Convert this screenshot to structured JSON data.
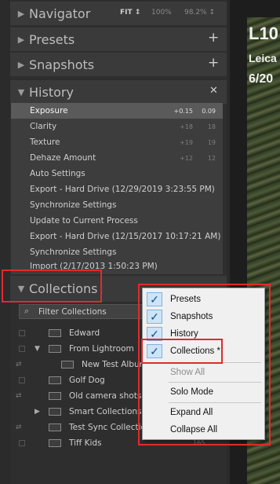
{
  "navigator": {
    "title": "Navigator",
    "fit": "FIT ↕",
    "zoom1": "100%",
    "zoom2": "98.2% ↕"
  },
  "presets": {
    "title": "Presets",
    "action": "+"
  },
  "snapshots": {
    "title": "Snapshots",
    "action": "+"
  },
  "history": {
    "title": "History",
    "action": "✕",
    "items": [
      {
        "label": "Exposure",
        "v1": "+0.15",
        "v2": "0.09"
      },
      {
        "label": "Clarity",
        "v1": "+18",
        "v2": "18"
      },
      {
        "label": "Texture",
        "v1": "+19",
        "v2": "19"
      },
      {
        "label": "Dehaze Amount",
        "v1": "+12",
        "v2": "12"
      },
      {
        "label": "Auto Settings",
        "v1": "",
        "v2": ""
      },
      {
        "label": "Export - Hard Drive (12/29/2019 3:23:55 PM)",
        "v1": "",
        "v2": ""
      },
      {
        "label": "Synchronize Settings",
        "v1": "",
        "v2": ""
      },
      {
        "label": "Update to Current Process",
        "v1": "",
        "v2": ""
      },
      {
        "label": "Export - Hard Drive (12/15/2017 10:17:21 AM)",
        "v1": "",
        "v2": ""
      },
      {
        "label": "Synchronize Settings",
        "v1": "",
        "v2": ""
      },
      {
        "label": "Import (2/17/2013 1:50:23 PM)",
        "v1": "",
        "v2": ""
      }
    ]
  },
  "collections": {
    "title": "Collections",
    "filter_placeholder": "Filter Collections",
    "items": [
      {
        "label": "Edward"
      },
      {
        "label": "From Lightroom"
      },
      {
        "label": "New Test Album"
      },
      {
        "label": "Golf Dog"
      },
      {
        "label": "Old camera shots"
      },
      {
        "label": "Smart Collections"
      },
      {
        "label": "Test Sync Collection"
      },
      {
        "label": "Tiff Kids",
        "count": "165"
      }
    ]
  },
  "context_menu": {
    "items": [
      {
        "label": "Presets",
        "checked": true
      },
      {
        "label": "Snapshots",
        "checked": true
      },
      {
        "label": "History",
        "checked": true
      },
      {
        "label": "Collections *",
        "checked": true
      },
      {
        "label": "Show All",
        "disabled": true
      },
      {
        "label": "Solo Mode"
      },
      {
        "label": "Expand All"
      },
      {
        "label": "Collapse All"
      }
    ]
  },
  "photo_info": {
    "line1": "L10",
    "line2": "Leica",
    "line3": "6/20"
  },
  "colors": {
    "highlight": "#e22a2a",
    "check_bg": "#cce4f7"
  }
}
